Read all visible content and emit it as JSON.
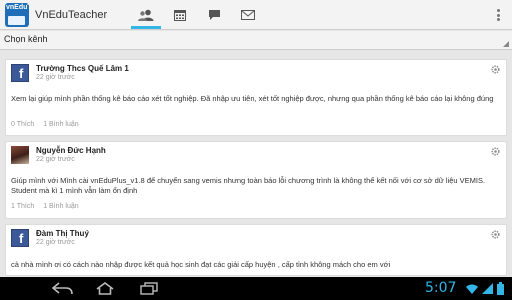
{
  "app": {
    "title": "VnEduTeacher",
    "logo_text": "vnEduT",
    "tabs": [
      {
        "name": "people",
        "icon": "people-icon",
        "active": true
      },
      {
        "name": "calendar",
        "icon": "calendar-icon",
        "active": false
      },
      {
        "name": "chat",
        "icon": "chat-bubble-icon",
        "active": false
      },
      {
        "name": "mail",
        "icon": "envelope-icon",
        "active": false
      }
    ]
  },
  "channel": {
    "label": "Chọn kênh"
  },
  "feed": [
    {
      "author": "Trường Thcs Quế Lâm 1",
      "time": "22 giờ trước",
      "avatar": "facebook",
      "text": "Xem lại giúp mình phần thống kê báo cáo xét tốt nghiệp. Đã nhập ưu tiên, xét tốt nghiệp được, nhưng qua phần thống kê báo cáo lại không đúng",
      "likes": "0 Thích",
      "comments": "1 Bình luận"
    },
    {
      "author": "Nguyễn Đức Hạnh",
      "time": "22 giờ trước",
      "avatar": "photo",
      "text": "Giúp mình với Mình cài vnEduPlus_v1.8 để chuyển sang vemis nhưng toàn báo lỗi chương trình là không thể kết nối với cơ sở dữ liệu VEMIS. Student mà kì 1 mình vẫn làm ổn định",
      "likes": "1 Thích",
      "comments": "1 Bình luận"
    },
    {
      "author": "Đàm Thị Thuý",
      "time": "22 giờ trước",
      "avatar": "facebook",
      "text": "cả nhà mình ơi có cách nào nhập được kết quả học sinh đạt các giải cấp huyện , cấp tỉnh không mách cho em với"
    }
  ],
  "system": {
    "clock": "5:07",
    "icons": [
      "back-icon",
      "home-icon",
      "recent-apps-icon",
      "wifi-icon",
      "signal-icon",
      "battery-icon"
    ]
  },
  "colors": {
    "accent": "#33b5e5",
    "facebook": "#3b5998"
  }
}
